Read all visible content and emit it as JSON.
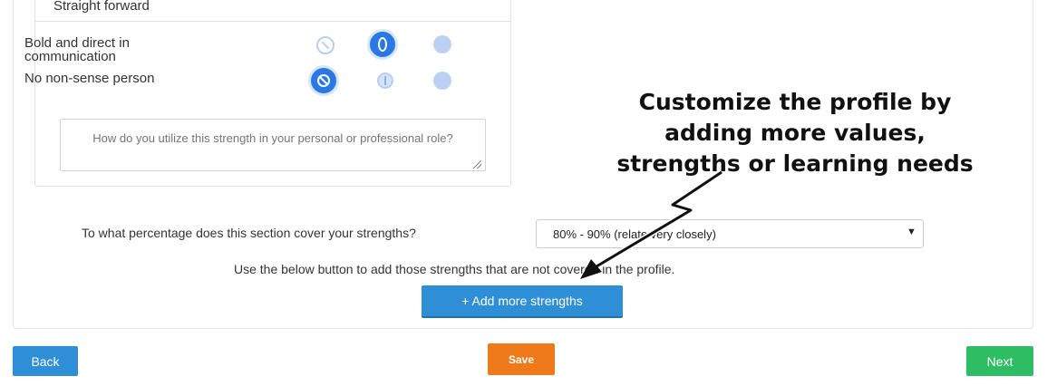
{
  "card": {
    "title": "Straight forward",
    "traits": [
      {
        "label": "Bold and direct in communication",
        "selected": "half"
      },
      {
        "label": "No non-sense person",
        "selected": "no"
      }
    ],
    "textarea_placeholder": "How do you utilize this strength in your personal or professional role?"
  },
  "coverage": {
    "question": "To what percentage does this section cover your strengths?",
    "selected_option": "80% - 90% (relate very closely)"
  },
  "help_text": "Use the below button to add those strengths that are not covered in the profile.",
  "add_button_label": "+ Add more strengths",
  "nav": {
    "back_label": "Back",
    "save_label": "Save",
    "next_label": "Next"
  },
  "annotation": {
    "lines": [
      "Customize the profile by",
      "adding more values,",
      "strengths or learning needs"
    ]
  },
  "colors": {
    "primary": "#2e8fd6",
    "save": "#ee7a1a",
    "next": "#2ebd63",
    "rating_selected": "#2a78e4"
  }
}
